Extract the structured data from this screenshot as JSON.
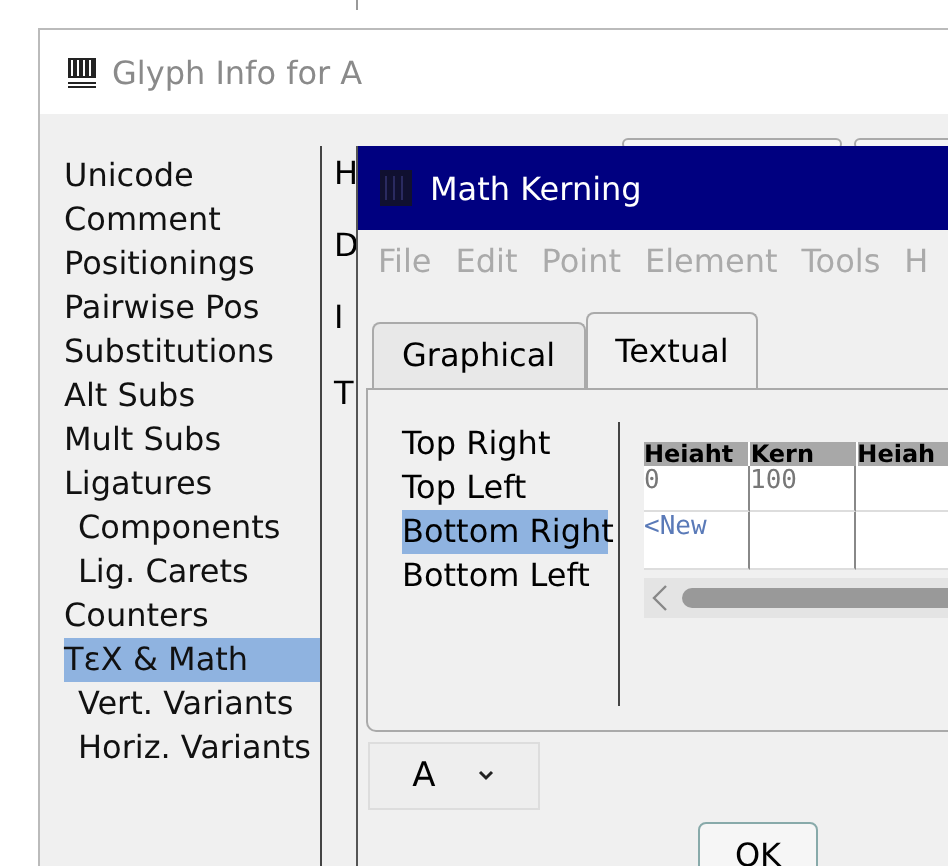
{
  "glyph_window": {
    "title": "Glyph Info for A",
    "sidebar": [
      {
        "label": "Unicode",
        "selected": false
      },
      {
        "label": "Comment",
        "selected": false
      },
      {
        "label": "Positionings",
        "selected": false
      },
      {
        "label": "Pairwise Pos",
        "selected": false
      },
      {
        "label": "Substitutions",
        "selected": false
      },
      {
        "label": "Alt Subs",
        "selected": false
      },
      {
        "label": "Mult Subs",
        "selected": false
      },
      {
        "label": "Ligatures",
        "selected": false,
        "children": [
          {
            "label": "Components",
            "selected": false
          },
          {
            "label": "Lig. Carets",
            "selected": false
          }
        ]
      },
      {
        "label": "Counters",
        "selected": false
      },
      {
        "label": "TεX & Math",
        "selected": true,
        "children": [
          {
            "label": "Vert. Variants",
            "selected": false
          },
          {
            "label": "Horiz. Variants",
            "selected": false
          }
        ]
      }
    ],
    "hidden_labels": [
      "H",
      "D",
      "I",
      "T"
    ]
  },
  "kerning_window": {
    "title": "Math Kerning",
    "menu": [
      {
        "label": "File",
        "disabled": true
      },
      {
        "label": "Edit",
        "disabled": true
      },
      {
        "label": "Point",
        "disabled": true
      },
      {
        "label": "Element",
        "disabled": true
      },
      {
        "label": "Tools",
        "disabled": true
      },
      {
        "label": "H",
        "disabled": true
      }
    ],
    "tabs": [
      {
        "label": "Graphical",
        "selected": false
      },
      {
        "label": "Textual",
        "selected": true
      }
    ],
    "corners": [
      {
        "label": "Top Right",
        "selected": false
      },
      {
        "label": "Top Left",
        "selected": false
      },
      {
        "label": "Bottom Right",
        "selected": true
      },
      {
        "label": "Bottom Left",
        "selected": false
      }
    ],
    "table": {
      "columns": [
        "Heiaht",
        "Kern",
        "Heiah"
      ],
      "rows": [
        [
          "0",
          "100",
          ""
        ],
        [
          "<New",
          "",
          ""
        ]
      ]
    },
    "glyph_select": "A",
    "ok_button": "OK"
  }
}
